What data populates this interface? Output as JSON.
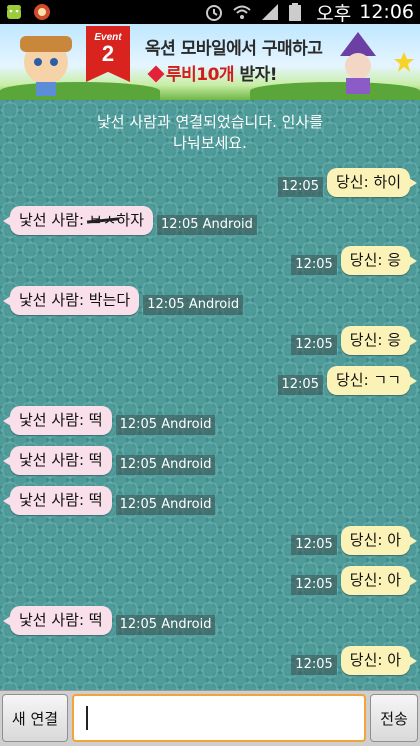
{
  "statusbar": {
    "ampm": "오후",
    "time": "12:06"
  },
  "banner": {
    "event_label": "Event",
    "event_number": "2",
    "line1": "옥션 모바일에서 구매하고",
    "line2_ruby": "루비10개",
    "line2_rest": " 받자!"
  },
  "system_message": {
    "line1": "낯선 사람과 연결되었습니다. 인사를",
    "line2": "나눠보세요."
  },
  "messages": [
    {
      "side": "me",
      "text": "당신: 하이",
      "time": "12:05"
    },
    {
      "side": "stranger",
      "prefix": "낯선 사람: ",
      "scribbled": "ㅂㅅ",
      "text_after": "하자",
      "time": "12:05",
      "platform": "Android"
    },
    {
      "side": "me",
      "text": "당신: 응",
      "time": "12:05"
    },
    {
      "side": "stranger",
      "text": "낯선 사람: 박는다",
      "time": "12:05",
      "platform": "Android"
    },
    {
      "side": "me",
      "text": "당신: 응",
      "time": "12:05"
    },
    {
      "side": "me",
      "text": "당신: ㄱㄱ",
      "time": "12:05"
    },
    {
      "side": "stranger",
      "text": "낯선 사람: 떡",
      "time": "12:05",
      "platform": "Android"
    },
    {
      "side": "stranger",
      "text": "낯선 사람: 떡",
      "time": "12:05",
      "platform": "Android"
    },
    {
      "side": "stranger",
      "text": "낯선 사람: 떡",
      "time": "12:05",
      "platform": "Android"
    },
    {
      "side": "me",
      "text": "당신: 아",
      "time": "12:05"
    },
    {
      "side": "me",
      "text": "당신: 아",
      "time": "12:05"
    },
    {
      "side": "stranger",
      "text": "낯선 사람: 떡",
      "time": "12:05",
      "platform": "Android"
    },
    {
      "side": "me",
      "text": "당신: 아",
      "time": "12:05"
    }
  ],
  "inputbar": {
    "new_connection_label": "새 연결",
    "send_label": "전송",
    "input_value": ""
  },
  "colors": {
    "chat_bg": "#4e9b9a",
    "stranger_bubble": "#f9dfe9",
    "me_bubble": "#fbf2b8",
    "input_border": "#f1a43c"
  },
  "icons": [
    "android-icon",
    "app-icon",
    "alarm-icon",
    "wifi-icon",
    "signal-icon",
    "battery-icon"
  ]
}
